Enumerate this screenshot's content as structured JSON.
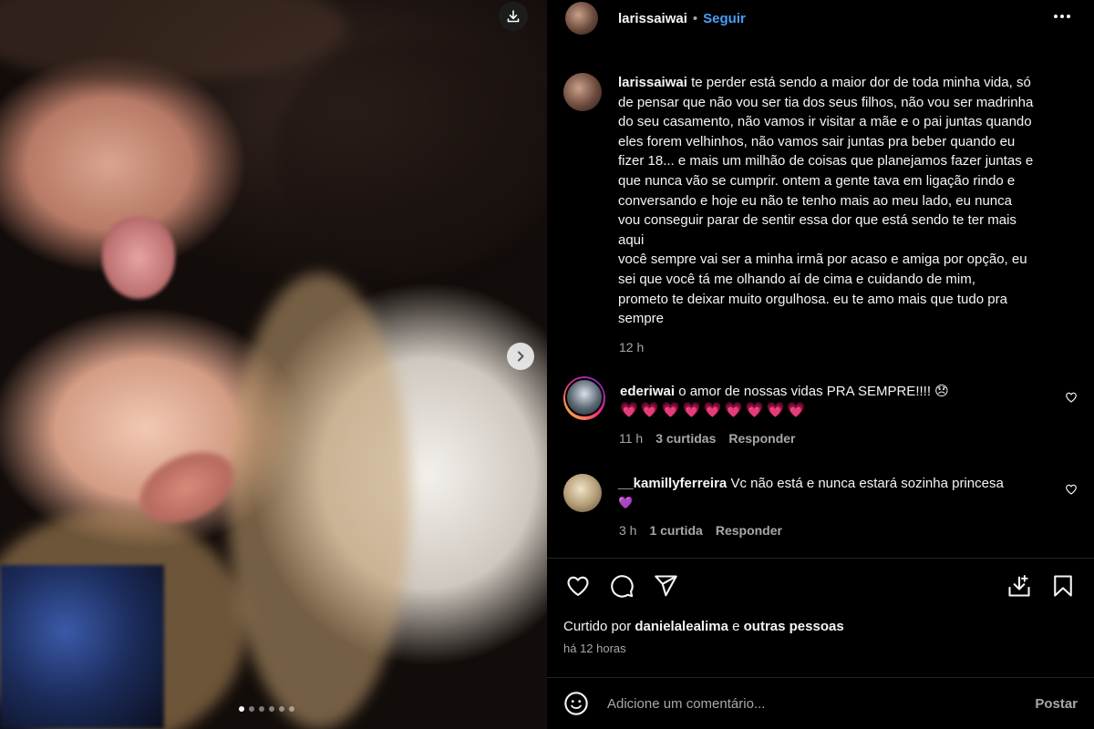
{
  "post": {
    "author": "larissaiwai",
    "separator": "•",
    "follow_label": "Seguir",
    "media": {
      "carousel_dots": 6,
      "active_dot": 0
    },
    "caption": {
      "username": "larissaiwai",
      "lines": [
        "te perder está sendo a maior dor de toda minha vida, só",
        "de pensar que não vou ser tia dos seus filhos, não vou ser madrinha",
        "do seu casamento, não vamos ir visitar a mãe e o pai juntas quando",
        "eles forem velhinhos, não vamos sair juntas pra beber quando eu",
        "fizer 18... e mais um milhão de coisas que planejamos fazer juntas e",
        "que nunca vão se cumprir. ontem a gente tava em ligação rindo e",
        "conversando e hoje eu não te tenho mais ao meu lado, eu nunca",
        "vou conseguir parar de sentir essa dor que está sendo te ter mais",
        "aqui",
        "você sempre vai ser a minha irmã por acaso e amiga por opção, eu",
        "sei que você tá me olhando aí de cima e cuidando de mim,",
        "prometo te deixar muito orgulhosa. eu te amo mais que tudo pra",
        "sempre"
      ],
      "time": "12 h"
    },
    "comments": [
      {
        "username": "ederiwai",
        "text": "o amor de nossas vidas PRA SEMPRE!!!! 😞",
        "hearts": "💗💗💗💗💗💗💗💗💗",
        "time": "11 h",
        "likes": "3 curtidas",
        "reply": "Responder"
      },
      {
        "username": "__kamillyferreira",
        "text": "Vc não está e nunca estará sozinha princesa",
        "emoji": "💜",
        "time": "3 h",
        "likes": "1 curtida",
        "reply": "Responder"
      }
    ],
    "liked_by": {
      "prefix": "Curtido por",
      "user": "danielalealima",
      "conj": "e",
      "others": "outras pessoas"
    },
    "age": "há 12 horas",
    "comment_input": {
      "placeholder": "Adicione um comentário...",
      "post_label": "Postar"
    }
  },
  "colors": {
    "background": "#000000",
    "text": "#f5f5f5",
    "muted": "#a8a8a8",
    "link": "#4a9cf6",
    "heart": "#ff3b8d"
  },
  "icons": [
    "download-icon",
    "chevron-right-icon",
    "more-icon",
    "heart-icon",
    "comment-icon",
    "share-icon",
    "save-collection-icon",
    "bookmark-icon",
    "emoji-icon"
  ]
}
